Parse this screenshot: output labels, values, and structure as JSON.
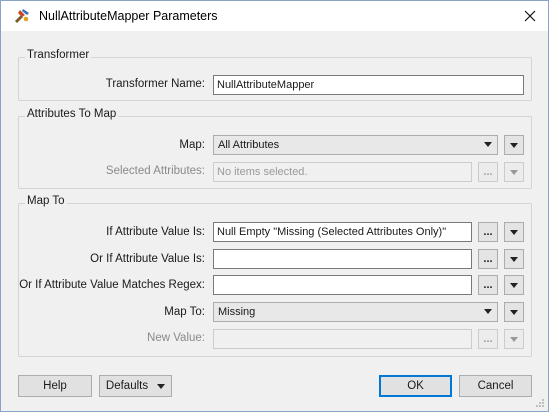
{
  "window": {
    "title": "NullAttributeMapper Parameters",
    "icons": {
      "app": "transformer-icon",
      "close": "close-icon"
    }
  },
  "transformer": {
    "group_title": "Transformer",
    "name_label": "Transformer Name:",
    "name_value": "NullAttributeMapper"
  },
  "attributes_to_map": {
    "group_title": "Attributes To Map",
    "map_label": "Map:",
    "map_value": "All Attributes",
    "selected_label": "Selected Attributes:",
    "selected_placeholder": "No items selected.",
    "selected_enabled": false
  },
  "map_to": {
    "group_title": "Map To",
    "if_value_label": "If Attribute Value Is:",
    "if_value_value": "Null Empty \"Missing (Selected Attributes Only)\"",
    "or_if_value_label": "Or If Attribute Value Is:",
    "or_if_value_value": "",
    "regex_label": "Or If Attribute Value Matches Regex:",
    "regex_value": "",
    "map_to_label": "Map To:",
    "map_to_value": "Missing",
    "new_value_label": "New Value:",
    "new_value_value": "",
    "new_value_enabled": false
  },
  "ellipsis": "...",
  "footer": {
    "help": "Help",
    "defaults": "Defaults",
    "ok": "OK",
    "cancel": "Cancel"
  }
}
